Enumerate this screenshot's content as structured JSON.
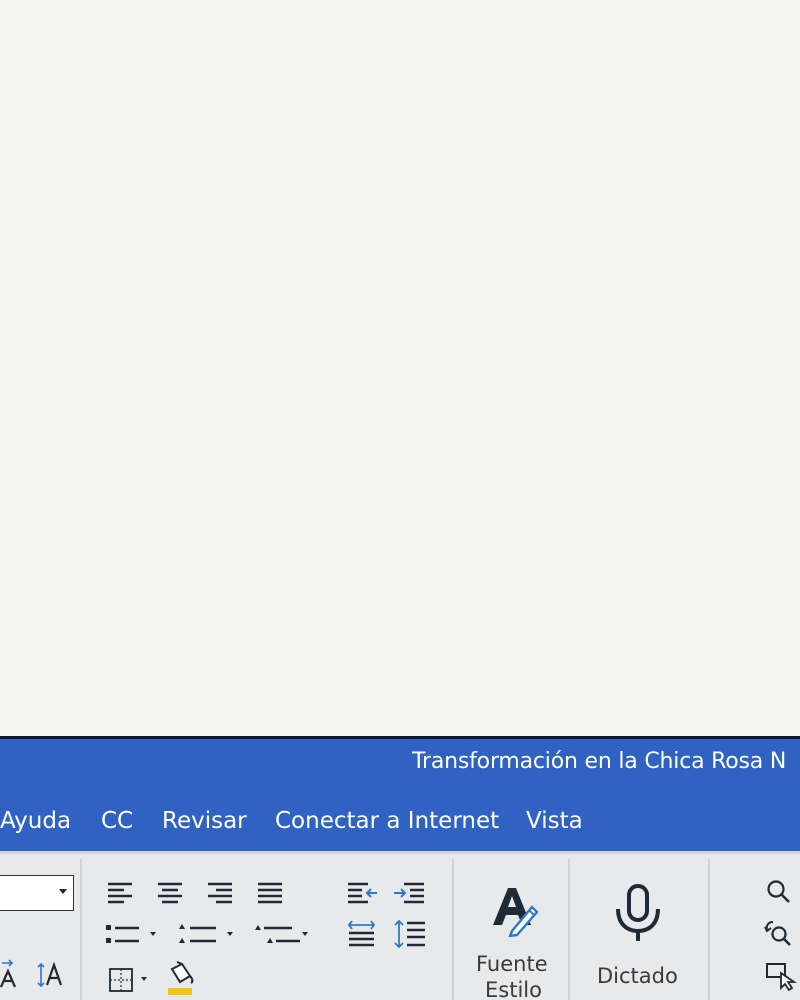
{
  "window": {
    "title": "Transformación en la Chica Rosa N"
  },
  "menu": {
    "items": [
      {
        "label": "Ayuda"
      },
      {
        "label": "CC"
      },
      {
        "label": "Revisar"
      },
      {
        "label": "Conectar a Internet"
      },
      {
        "label": "Vista"
      }
    ]
  },
  "ribbon": {
    "font_name": "",
    "fuente_estilo_label_1": "Fuente",
    "fuente_estilo_label_2": "Estilo",
    "dictado_label": "Dictado"
  },
  "colors": {
    "title_bar": "#2f62c2",
    "ribbon_bg": "#e8e9ea",
    "highlight_swatch": "#f2c318",
    "icon_blue": "#2f78c9",
    "icon_dark": "#1f2a36"
  },
  "icons": [
    "align-left-icon",
    "align-center-icon",
    "align-right-icon",
    "justify-icon",
    "decrease-indent-icon",
    "increase-indent-icon",
    "bullet-list-icon",
    "numbered-list-icon",
    "multilevel-list-icon",
    "paragraph-spacing-icon",
    "line-spacing-icon",
    "borders-icon",
    "paint-bucket-icon",
    "shrink-font-icon",
    "text-direction-icon",
    "font-style-pen-icon",
    "microphone-icon",
    "search-icon",
    "replace-icon",
    "select-icon"
  ]
}
